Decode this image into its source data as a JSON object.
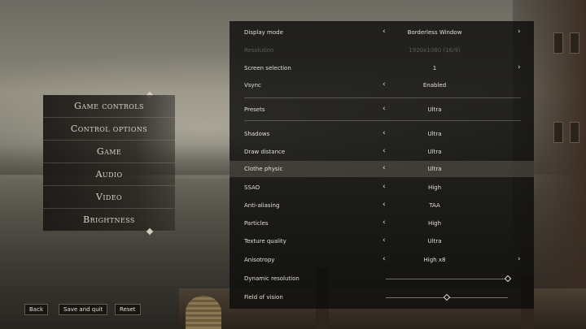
{
  "menu": {
    "items": [
      {
        "label": "Game controls"
      },
      {
        "label": "Control options"
      },
      {
        "label": "Game"
      },
      {
        "label": "Audio"
      },
      {
        "label": "Video"
      },
      {
        "label": "Brightness"
      }
    ]
  },
  "buttons": {
    "back": "Back",
    "save_and_quit": "Save and quit",
    "reset": "Reset"
  },
  "settings": {
    "display_mode": {
      "label": "Display mode",
      "value": "Borderless Window"
    },
    "resolution": {
      "label": "Resolution",
      "value": "1920x1080 (16/9)"
    },
    "screen_selection": {
      "label": "Screen selection",
      "value": "1"
    },
    "vsync": {
      "label": "Vsync",
      "value": "Enabled"
    },
    "presets": {
      "label": "Presets",
      "value": "Ultra"
    },
    "shadows": {
      "label": "Shadows",
      "value": "Ultra"
    },
    "draw_distance": {
      "label": "Draw distance",
      "value": "Ultra"
    },
    "clothe_physic": {
      "label": "Clothe physic",
      "value": "Ultra"
    },
    "ssao": {
      "label": "SSAO",
      "value": "High"
    },
    "anti_aliasing": {
      "label": "Anti-aliasing",
      "value": "TAA"
    },
    "particles": {
      "label": "Particles",
      "value": "High"
    },
    "texture_quality": {
      "label": "Texture quality",
      "value": "Ultra"
    },
    "anisotropy": {
      "label": "Anisotropy",
      "value": "High x8"
    },
    "dynamic_resolution": {
      "label": "Dynamic resolution",
      "level": 1.0
    },
    "field_of_vision": {
      "label": "Field of vision",
      "level": 0.5
    }
  },
  "icons": {
    "arrow_left": "‹",
    "arrow_right": "›"
  }
}
